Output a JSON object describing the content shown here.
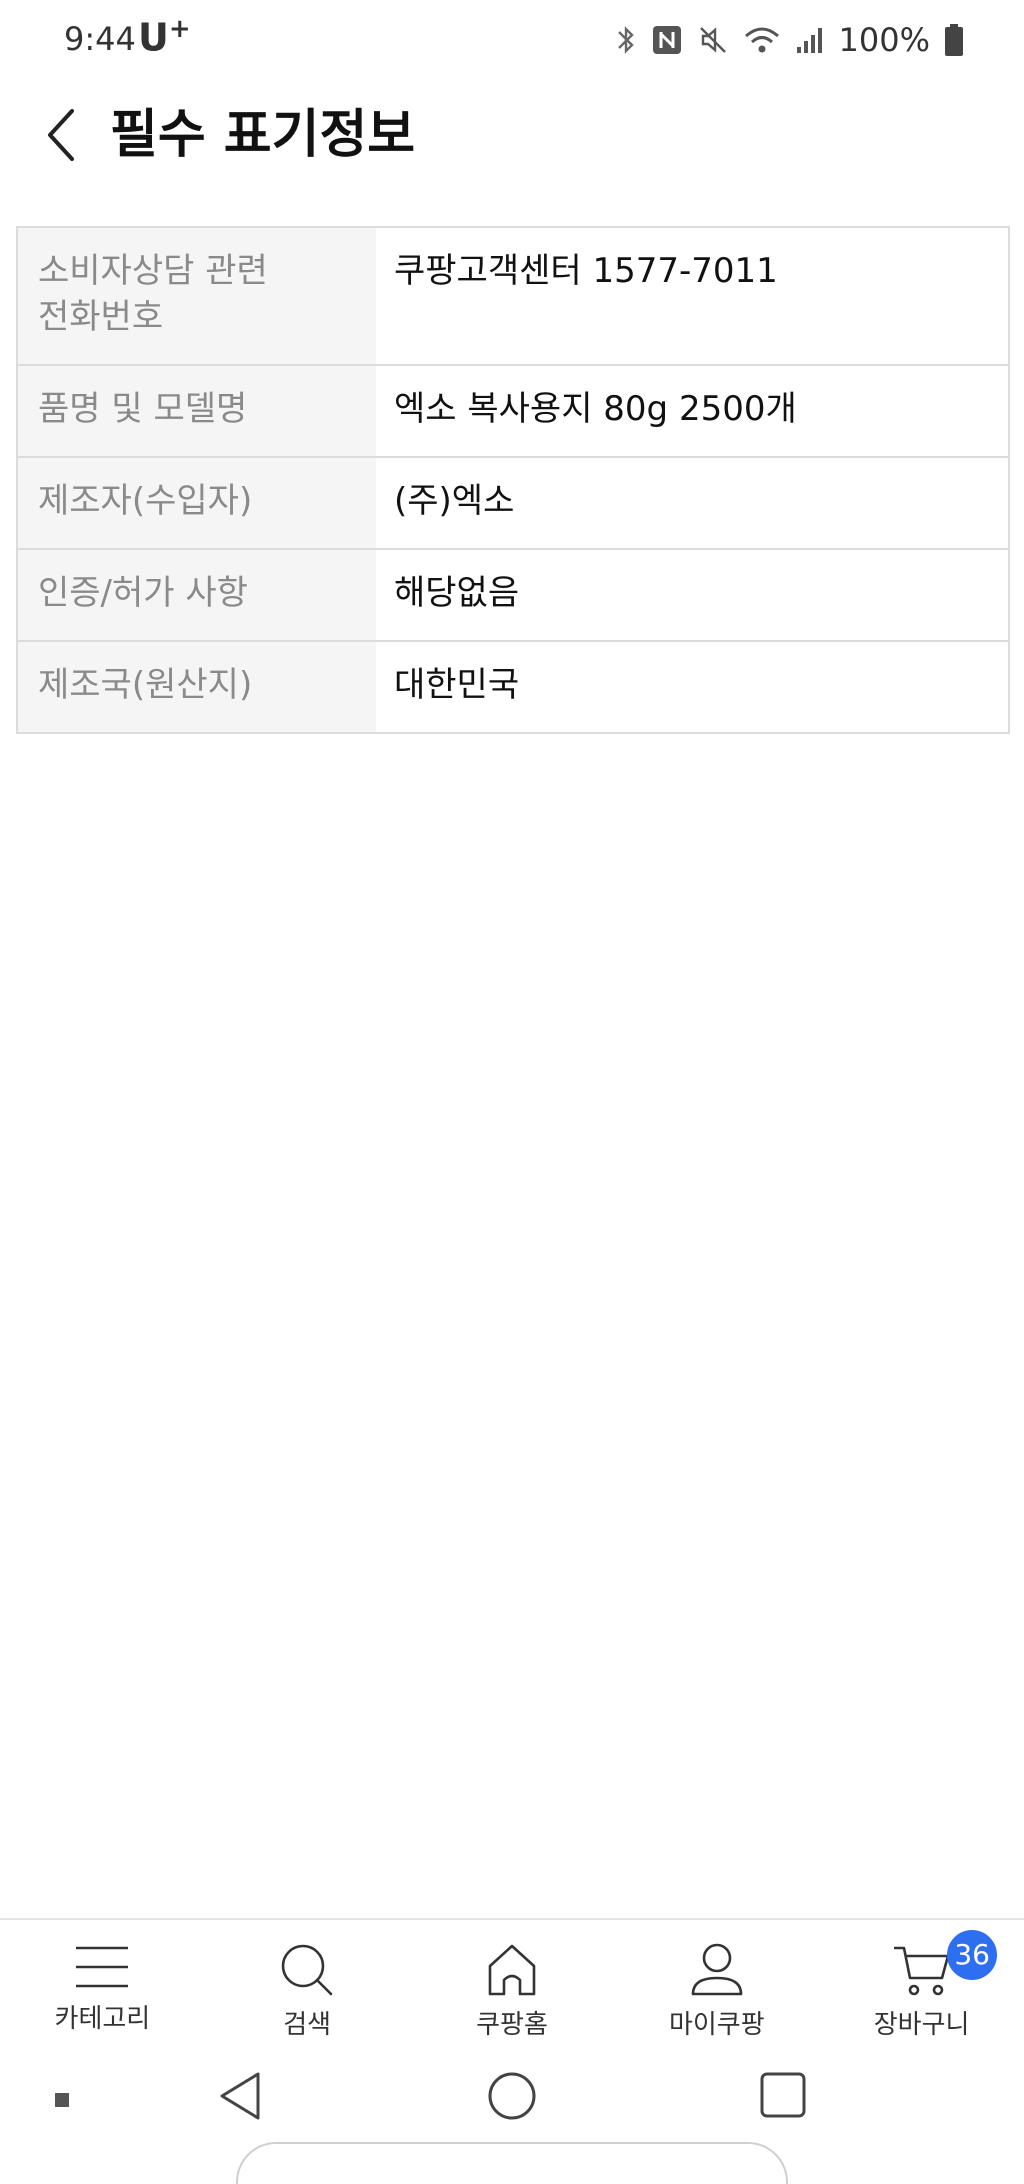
{
  "status_bar": {
    "time": "9:44",
    "carrier": "U",
    "carrier_plus": "+",
    "battery": "100%"
  },
  "header": {
    "title": "필수 표기정보"
  },
  "info_table": {
    "rows": [
      {
        "label": "소비자상담 관련\n전화번호",
        "value": "쿠팡고객센터 1577-7011"
      },
      {
        "label": "품명 및 모델명",
        "value": "엑소 복사용지 80g 2500개"
      },
      {
        "label": "제조자(수입자)",
        "value": "(주)엑소"
      },
      {
        "label": "인증/허가 사항",
        "value": "해당없음"
      },
      {
        "label": "제조국(원산지)",
        "value": "대한민국"
      }
    ]
  },
  "bottom_nav": {
    "items": [
      {
        "label": "카테고리",
        "icon": "menu-icon"
      },
      {
        "label": "검색",
        "icon": "search-icon"
      },
      {
        "label": "쿠팡홈",
        "icon": "home-icon"
      },
      {
        "label": "마이쿠팡",
        "icon": "user-icon"
      },
      {
        "label": "장바구니",
        "icon": "cart-icon"
      }
    ],
    "cart_count": "36"
  },
  "colors": {
    "accent": "#2e6ff2",
    "label_bg": "#f5f5f5",
    "label_text": "#8a8a8a",
    "border": "#dcdcdc"
  }
}
